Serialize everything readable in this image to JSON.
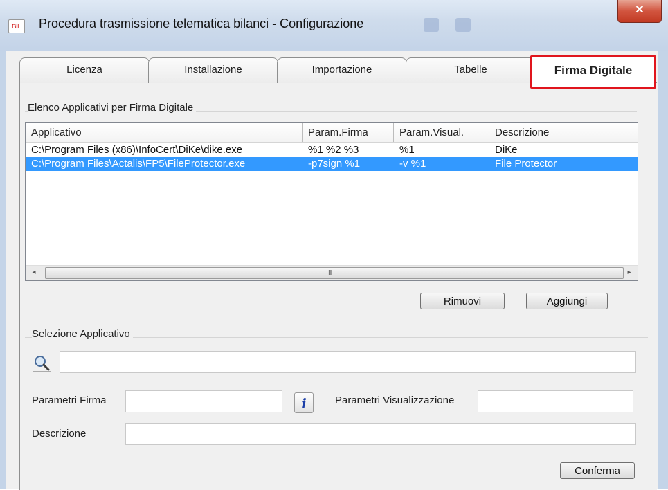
{
  "window": {
    "title": "Procedura trasmissione telematica bilanci - Configurazione",
    "app_icon_text": "BIL",
    "close_glyph": "✕"
  },
  "tabs": [
    {
      "label": "Licenza"
    },
    {
      "label": "Installazione"
    },
    {
      "label": "Importazione"
    },
    {
      "label": "Tabelle"
    },
    {
      "label": "Firma Digitale",
      "active": true
    }
  ],
  "apps_group": {
    "title": "Elenco Applicativi  per Firma Digitale",
    "columns": [
      "Applicativo",
      "Param.Firma",
      "Param.Visual.",
      "Descrizione"
    ],
    "rows": [
      {
        "applicativo": "C:\\Program Files (x86)\\InfoCert\\DiKe\\dike.exe",
        "param_firma": "%1 %2 %3",
        "param_visual": "%1",
        "descrizione": "DiKe",
        "selected": false
      },
      {
        "applicativo": "C:\\Program Files\\Actalis\\FP5\\FileProtector.exe",
        "param_firma": "-p7sign %1",
        "param_visual": "-v %1",
        "descrizione": "File Protector",
        "selected": true
      }
    ],
    "scroll_left": "◂",
    "scroll_right": "▸",
    "scroll_grip": "III",
    "remove_label": "Rimuovi",
    "add_label": "Aggiungi"
  },
  "selection_group": {
    "title": "Selezione Applicativo",
    "path_value": "",
    "param_firma_label": "Parametri Firma",
    "param_firma_value": "",
    "info_glyph": "i",
    "param_visual_label": "Parametri Visualizzazione",
    "param_visual_value": "",
    "descrizione_label": "Descrizione",
    "descrizione_value": "",
    "confirm_label": "Conferma"
  },
  "colors": {
    "selection": "#3399ff",
    "active_tab_border": "#e0151d",
    "close_button": "#c94a35"
  }
}
